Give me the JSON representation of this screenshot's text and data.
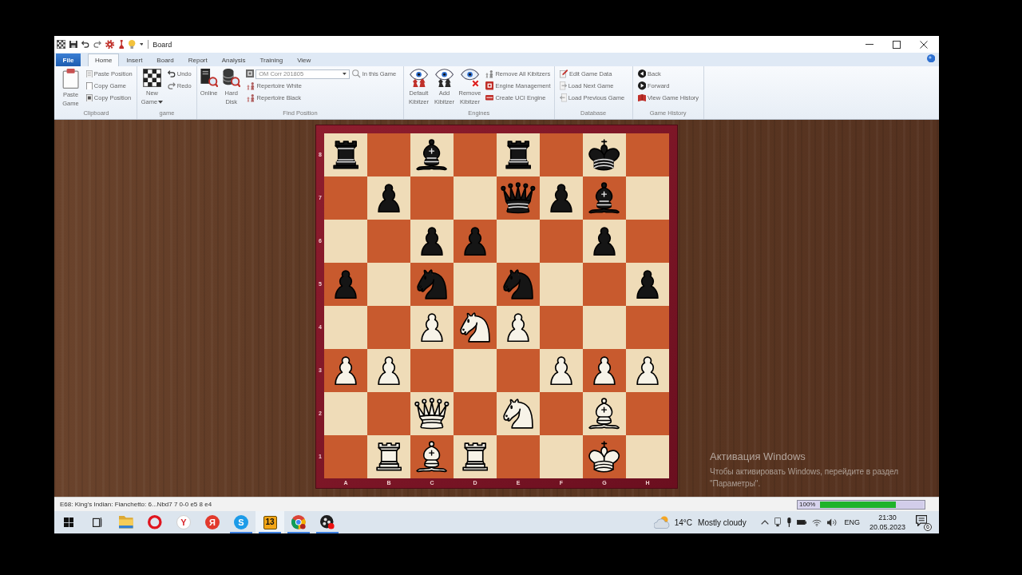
{
  "window": {
    "title": "Board"
  },
  "ribbon": {
    "file_menu": {
      "label": "File"
    },
    "tabs": [
      {
        "label": "Home",
        "selected": true
      },
      {
        "label": "Insert",
        "selected": false
      },
      {
        "label": "Board",
        "selected": false
      },
      {
        "label": "Report",
        "selected": false
      },
      {
        "label": "Analysis",
        "selected": false
      },
      {
        "label": "Training",
        "selected": false
      },
      {
        "label": "View",
        "selected": false
      }
    ],
    "groups": [
      {
        "label": "Clipboard",
        "large_buttons": [
          {
            "label": "Paste Game",
            "dropdown": false
          }
        ],
        "small_buttons": [
          {
            "label": "Paste Position"
          },
          {
            "label": "Copy Game"
          },
          {
            "label": "Copy Position"
          }
        ]
      },
      {
        "label": "game",
        "large_buttons": [
          {
            "label": "New Game",
            "dropdown": true
          }
        ],
        "small_buttons": [
          {
            "label": "Undo"
          },
          {
            "label": "Redo"
          }
        ]
      },
      {
        "label": "Find Position",
        "large_buttons": [
          {
            "label": "Online",
            "dropdown": false
          },
          {
            "label": "Hard Disk",
            "dropdown": false
          }
        ],
        "database_select": {
          "value": "OM Corr 201805"
        },
        "small_buttons": [
          {
            "label": "In this Game"
          },
          {
            "label": "Repertoire White"
          },
          {
            "label": "Repertoire Black"
          }
        ]
      },
      {
        "label": "Engines",
        "large_buttons": [
          {
            "label": "Default Kibitzer",
            "dropdown": false
          },
          {
            "label": "Add Kibitzer",
            "dropdown": false
          },
          {
            "label": "Remove Kibitzer",
            "dropdown": false
          }
        ],
        "small_buttons": [
          {
            "label": "Remove All Kibitzers"
          },
          {
            "label": "Engine Management"
          },
          {
            "label": "Create UCI Engine"
          }
        ]
      },
      {
        "label": "Database",
        "small_buttons": [
          {
            "label": "Edit Game Data"
          },
          {
            "label": "Load Next Game"
          },
          {
            "label": "Load Previous Game"
          }
        ]
      },
      {
        "label": "Game History",
        "small_buttons": [
          {
            "label": "Back"
          },
          {
            "label": "Forward"
          },
          {
            "label": "View Game History"
          }
        ]
      }
    ]
  },
  "board": {
    "ranks": [
      {
        "label": "8",
        "squares": [
          {
            "kind": "rook",
            "color": "#151515"
          },
          {
            "kind": "empty"
          },
          {
            "kind": "bishop",
            "color": "#151515"
          },
          {
            "kind": "empty"
          },
          {
            "kind": "rook",
            "color": "#151515"
          },
          {
            "kind": "empty"
          },
          {
            "kind": "king",
            "color": "#151515"
          },
          {
            "kind": "empty"
          }
        ]
      },
      {
        "label": "7",
        "squares": [
          {
            "kind": "empty"
          },
          {
            "kind": "pawn",
            "color": "#151515"
          },
          {
            "kind": "empty"
          },
          {
            "kind": "empty"
          },
          {
            "kind": "queen",
            "color": "#151515"
          },
          {
            "kind": "pawn",
            "color": "#151515"
          },
          {
            "kind": "bishop",
            "color": "#151515"
          },
          {
            "kind": "empty"
          }
        ]
      },
      {
        "label": "6",
        "squares": [
          {
            "kind": "empty"
          },
          {
            "kind": "empty"
          },
          {
            "kind": "pawn",
            "color": "#151515"
          },
          {
            "kind": "pawn",
            "color": "#151515"
          },
          {
            "kind": "empty"
          },
          {
            "kind": "empty"
          },
          {
            "kind": "pawn",
            "color": "#151515"
          },
          {
            "kind": "empty"
          }
        ]
      },
      {
        "label": "5",
        "squares": [
          {
            "kind": "pawn",
            "color": "#151515"
          },
          {
            "kind": "empty"
          },
          {
            "kind": "knight",
            "color": "#151515"
          },
          {
            "kind": "empty"
          },
          {
            "kind": "knight",
            "color": "#151515"
          },
          {
            "kind": "empty"
          },
          {
            "kind": "empty"
          },
          {
            "kind": "pawn",
            "color": "#151515"
          }
        ]
      },
      {
        "label": "4",
        "squares": [
          {
            "kind": "empty"
          },
          {
            "kind": "empty"
          },
          {
            "kind": "pawn",
            "color": "#f7f3e8"
          },
          {
            "kind": "knight",
            "color": "#f7f3e8"
          },
          {
            "kind": "pawn",
            "color": "#f7f3e8"
          },
          {
            "kind": "empty"
          },
          {
            "kind": "empty"
          },
          {
            "kind": "empty"
          }
        ]
      },
      {
        "label": "3",
        "squares": [
          {
            "kind": "pawn",
            "color": "#f7f3e8"
          },
          {
            "kind": "pawn",
            "color": "#f7f3e8"
          },
          {
            "kind": "empty"
          },
          {
            "kind": "empty"
          },
          {
            "kind": "empty"
          },
          {
            "kind": "pawn",
            "color": "#f7f3e8"
          },
          {
            "kind": "pawn",
            "color": "#f7f3e8"
          },
          {
            "kind": "pawn",
            "color": "#f7f3e8"
          }
        ]
      },
      {
        "label": "2",
        "squares": [
          {
            "kind": "empty"
          },
          {
            "kind": "empty"
          },
          {
            "kind": "queen",
            "color": "#f7f3e8"
          },
          {
            "kind": "empty"
          },
          {
            "kind": "knight",
            "color": "#f7f3e8"
          },
          {
            "kind": "empty"
          },
          {
            "kind": "bishop",
            "color": "#f7f3e8"
          },
          {
            "kind": "empty"
          }
        ]
      },
      {
        "label": "1",
        "squares": [
          {
            "kind": "empty"
          },
          {
            "kind": "rook",
            "color": "#f7f3e8"
          },
          {
            "kind": "bishop",
            "color": "#f7f3e8"
          },
          {
            "kind": "rook",
            "color": "#f7f3e8"
          },
          {
            "kind": "empty"
          },
          {
            "kind": "empty"
          },
          {
            "kind": "king",
            "color": "#f7f3e8"
          },
          {
            "kind": "empty"
          }
        ]
      }
    ],
    "files": [
      "A",
      "B",
      "C",
      "D",
      "E",
      "F",
      "G",
      "H"
    ]
  },
  "activation_notice": {
    "title": "Активация Windows",
    "text": "Чтобы активировать Windows, перейдите в раздел \"Параметры\"."
  },
  "status_bar": {
    "text": "E68: King's Indian: Fianchetto: 6...Nbd7 7 0-0 e5 8 e4",
    "progress": {
      "label": "100%",
      "level": 0.74
    }
  },
  "taskbar": {
    "apps": [
      {
        "kind": "start",
        "running": false,
        "selected": false
      },
      {
        "kind": "task-view",
        "running": false,
        "selected": false
      },
      {
        "kind": "folder",
        "running": false,
        "selected": false
      },
      {
        "kind": "ring",
        "running": false,
        "selected": false
      },
      {
        "kind": "outline-letter",
        "label": "Y",
        "color": "#d9262c",
        "running": false,
        "selected": false
      },
      {
        "kind": "letter",
        "label": "Я",
        "color": "#e2392c",
        "running": false,
        "selected": false
      },
      {
        "kind": "letter",
        "label": "S",
        "color": "#1c9be8",
        "running": true,
        "selected": false
      },
      {
        "kind": "tile",
        "label": "13",
        "color": "#f2a516",
        "running": true,
        "selected": true
      },
      {
        "kind": "wheel",
        "running": true,
        "selected": false
      },
      {
        "kind": "disc",
        "running": true,
        "selected": false
      }
    ],
    "weather": {
      "temperature": "14°C",
      "condition": "Mostly cloudy"
    },
    "language": "ENG",
    "clock": {
      "time": "21:30",
      "date": "20.05.2023"
    },
    "notifications": {
      "count": "6"
    }
  }
}
